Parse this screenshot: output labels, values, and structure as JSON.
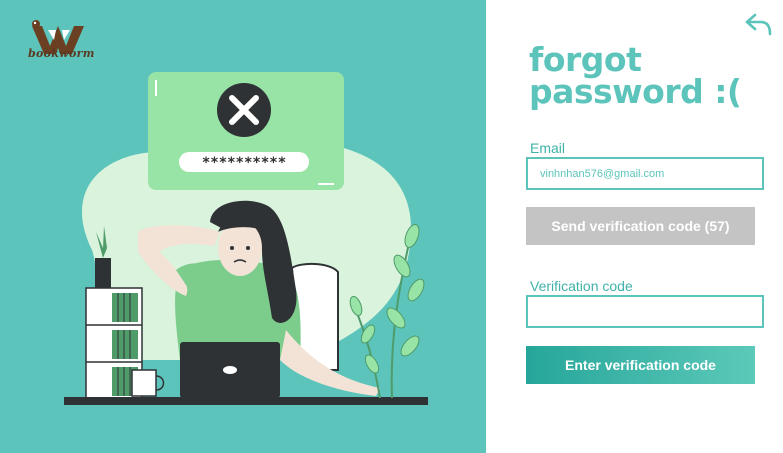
{
  "brand": {
    "name": "bookworm"
  },
  "illustration": {
    "password_mask": "**********"
  },
  "form": {
    "title_line1": "forgot",
    "title_line2": "password :(",
    "email_label": "Email",
    "email_value": "vinhnhan576@gmail.com",
    "send_button_label": "Send verification code (57)",
    "verification_label": "Verification code",
    "verification_value": "",
    "enter_button_label": "Enter verification code"
  },
  "colors": {
    "teal": "#5cc4ba",
    "teal_dark": "#26a69a",
    "disabled_gray": "#c4c4c4",
    "card_green": "#98e3a6"
  },
  "icons": [
    "back-arrow-icon",
    "close-icon",
    "bookworm-logo"
  ]
}
